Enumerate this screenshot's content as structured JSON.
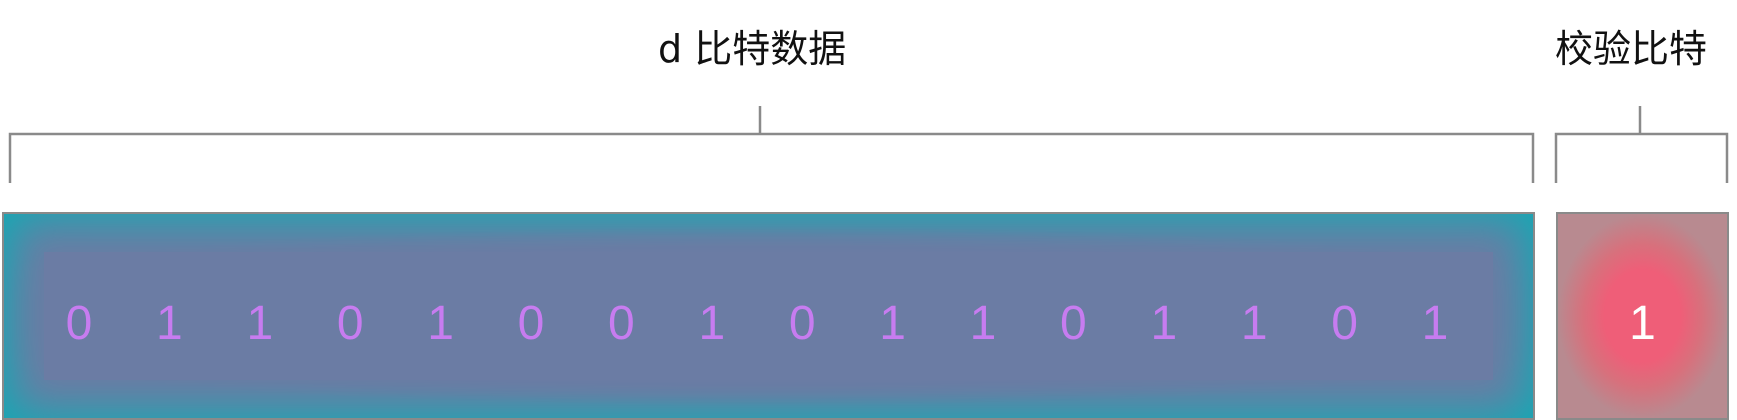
{
  "labels": {
    "data": "d 比特数据",
    "parity": "校验比特"
  },
  "data_bits": [
    "0",
    "1",
    "1",
    "0",
    "1",
    "0",
    "0",
    "1",
    "0",
    "1",
    "1",
    "0",
    "1",
    "1",
    "0",
    "1"
  ],
  "parity_bit": "1",
  "colors": {
    "data_block": "#1aaab4",
    "data_inner": "#6b7ca4",
    "data_bit_text": "#c77cf0",
    "parity_block": "#ef5e78",
    "parity_bit_text": "#ffffff",
    "bracket": "#8a8a8a"
  }
}
